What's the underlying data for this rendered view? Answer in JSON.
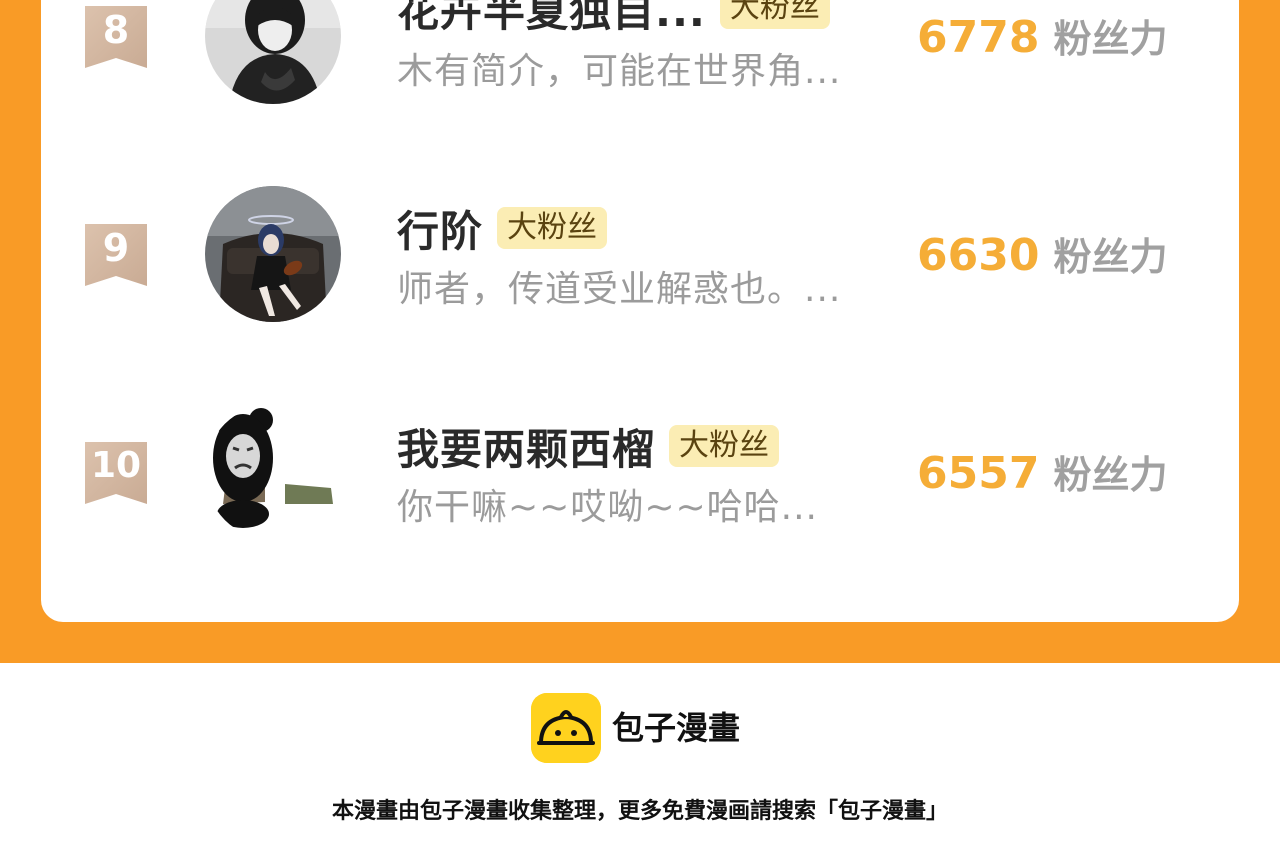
{
  "ranking": {
    "entries": [
      {
        "rank": "8",
        "name": "花卉半夏独自...",
        "badge": "大粉丝",
        "bio": "木有简介，可能在世界角...",
        "score": "6778",
        "score_unit": "粉丝力"
      },
      {
        "rank": "9",
        "name": "行阶",
        "badge": "大粉丝",
        "bio": "师者，传道受业解惑也。...",
        "score": "6630",
        "score_unit": "粉丝力"
      },
      {
        "rank": "10",
        "name": "我要两颗西榴",
        "badge": "大粉丝",
        "bio": "你干嘛~~哎呦~~哈哈...",
        "score": "6557",
        "score_unit": "粉丝力"
      }
    ]
  },
  "footer": {
    "brand": "包子漫畫",
    "notice": "本漫畫由包子漫畫收集整理，更多免費漫画請搜索「包子漫畫」"
  },
  "colors": {
    "frame_orange": "#f99b26",
    "score_gold": "#f5ad37",
    "badge_bg": "#fbedb4",
    "ribbon": "#d4b9a4",
    "logo_yellow": "#ffd21e"
  },
  "icons": {
    "rank": "rank-ribbon-icon",
    "logo": "baozi-logo-icon"
  }
}
